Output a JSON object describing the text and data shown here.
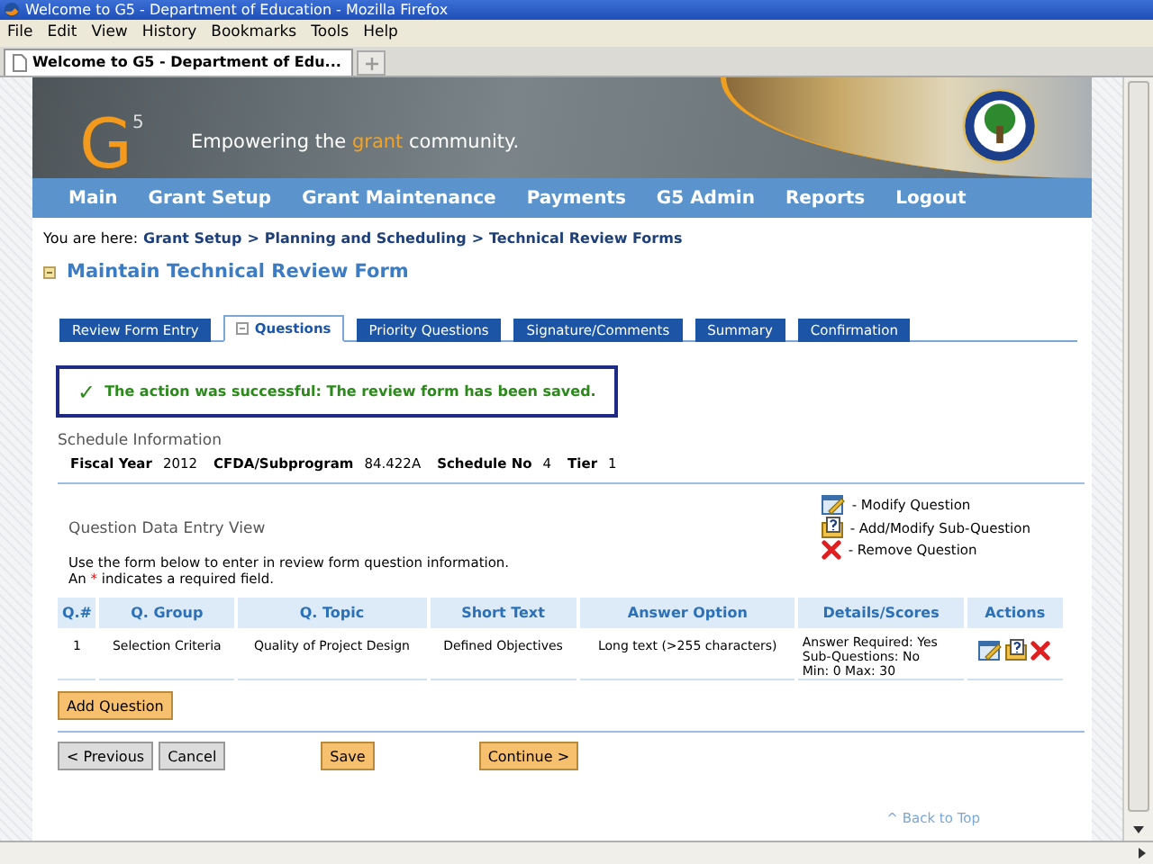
{
  "browser": {
    "title": "Welcome to G5 - Department of Education - Mozilla Firefox",
    "menu": [
      "File",
      "Edit",
      "View",
      "History",
      "Bookmarks",
      "Tools",
      "Help"
    ],
    "tabs": [
      {
        "label": "Welcome to G5 - Department of Edu...",
        "selected": true
      }
    ]
  },
  "banner": {
    "logo": "G$^{5}$",
    "tagline": {
      "before": "Empowering the",
      "highlight": "grant",
      "after": "community."
    }
  },
  "nav": [
    "Main",
    "Grant Setup",
    "Grant Maintenance",
    "Payments",
    "G5 Admin",
    "Reports",
    "Logout"
  ],
  "breadcrumb": {
    "label": "You are here:",
    "separator": ">",
    "links": [
      "Grant Setup",
      "Planning and Scheduling",
      "Technical Review Forms"
    ]
  },
  "heading": "Maintain Technical Review Form",
  "form_tabs": [
    {
      "label": "Review Form Entry",
      "selected": false
    },
    {
      "label": "Questions",
      "selected": true
    },
    {
      "label": "Priority Questions",
      "selected": false
    },
    {
      "label": "Signature/Comments",
      "selected": false
    },
    {
      "label": "Summary",
      "selected": false
    },
    {
      "label": "Confirmation",
      "selected": false
    }
  ],
  "message": {
    "icon": "✓",
    "text": "The action was successful: The review form has been saved."
  },
  "schedule": {
    "title": "Schedule Information",
    "fields": [
      {
        "label": "Fiscal Year",
        "value": "2012"
      },
      {
        "label": "CFDA/Subprogram",
        "value": "84.422A"
      },
      {
        "label": "Schedule No",
        "value": "4"
      },
      {
        "label": "Tier",
        "value": "1"
      }
    ]
  },
  "section_title": "Question Data Entry View",
  "legend": [
    {
      "kind": "modify",
      "label": "- Modify Question"
    },
    {
      "kind": "add",
      "label": "- Add/Modify Sub-Question"
    },
    {
      "kind": "remove",
      "label": "- Remove Question"
    }
  ],
  "instructions": "Use the form below to enter in review form question information.",
  "required_note": {
    "before": "An",
    "mark": "*",
    "after": "indicates a required field."
  },
  "table": {
    "columns": [
      "Q.#",
      "Q. Group",
      "Q. Topic",
      "Short Text",
      "Answer Option",
      "Details/Scores",
      "Actions"
    ],
    "rows": [
      {
        "cells": [
          "1",
          "Selection Criteria",
          "Quality of Project Design",
          "Defined Objectives",
          "Long text (>255 characters)"
        ],
        "details": [
          "Answer Required: Yes",
          "Sub-Questions: No",
          "Min: 0 Max: 30"
        ],
        "actions": [
          {
            "kind": "modify"
          },
          {
            "kind": "add"
          },
          {
            "kind": "remove"
          }
        ]
      }
    ]
  },
  "add_button": "Add Question",
  "buttons": [
    {
      "label": "< Previous",
      "kind": "secondary"
    },
    {
      "label": "Cancel",
      "kind": "secondary"
    },
    {
      "label": "Save",
      "kind": "primary"
    },
    {
      "label": "Continue >",
      "kind": "primary"
    }
  ],
  "back_to_top": "^ Back to Top"
}
